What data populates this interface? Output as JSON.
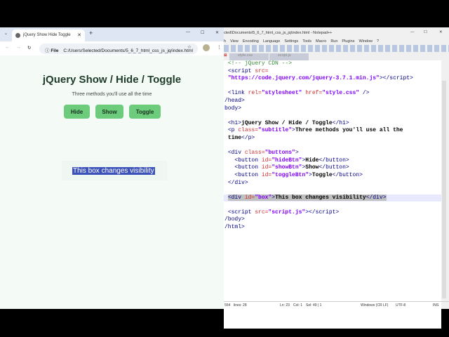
{
  "browser": {
    "tab_title": "jQuery Show Hide Toggle",
    "file_label": "File",
    "url": "C:/Users/Selected/Documents/5_6_7_html_css_js_jq/index.html",
    "page": {
      "title": "jQuery Show / Hide / Toggle",
      "subtitle": "Three methods you'll use all the time",
      "buttons": [
        "Hide",
        "Show",
        "Toggle"
      ],
      "box": "This box changes visibility"
    }
  },
  "notepad": {
    "title": "cted\\Documents\\5_6_7_html_css_js_jq\\index.html - Notepad++",
    "menu": [
      "h",
      "View",
      "Encoding",
      "Language",
      "Settings",
      "Tools",
      "Macro",
      "Run",
      "Plugins",
      "Window",
      "?"
    ],
    "tabs": [
      "style.css",
      "script.js"
    ],
    "code": [
      [
        [
          "<!-- jQuery CDN -->",
          "cm"
        ]
      ],
      [
        [
          "<script ",
          "tag"
        ],
        [
          "src=",
          "an"
        ]
      ],
      [
        [
          "\"https://code.jquery.com/jquery-3.7.1.min.js\"",
          "av"
        ],
        [
          "></script>",
          "tag"
        ]
      ],
      [],
      [
        [
          "<link ",
          "tag"
        ],
        [
          "rel=",
          "an"
        ],
        [
          "\"stylesheet\"",
          "av"
        ],
        [
          " href=",
          "an"
        ],
        [
          "\"style.css\"",
          "av"
        ],
        [
          " />",
          "tag"
        ]
      ],
      [
        [
          "/head>",
          "tag"
        ]
      ],
      [
        [
          "body>",
          "tag"
        ]
      ],
      [],
      [
        [
          "<h1>",
          "tag"
        ],
        [
          "jQuery Show / Hide / Toggle",
          "tx"
        ],
        [
          "</h1>",
          "tag"
        ]
      ],
      [
        [
          "<p ",
          "tag"
        ],
        [
          "class=",
          "an"
        ],
        [
          "\"subtitle\"",
          "av"
        ],
        [
          ">",
          "tag"
        ],
        [
          "Three methods you'll use all the",
          "tx"
        ]
      ],
      [
        [
          "time",
          "tx"
        ],
        [
          "</p>",
          "tag"
        ]
      ],
      [],
      [
        [
          "<div ",
          "tag"
        ],
        [
          "class=",
          "an"
        ],
        [
          "\"buttons\"",
          "av"
        ],
        [
          ">",
          "tag"
        ]
      ],
      [
        [
          "  <button ",
          "tag"
        ],
        [
          "id=",
          "an"
        ],
        [
          "\"hideBtn\"",
          "av"
        ],
        [
          ">",
          "tag"
        ],
        [
          "Hide",
          "tx"
        ],
        [
          "</button>",
          "tag"
        ]
      ],
      [
        [
          "  <button ",
          "tag"
        ],
        [
          "id=",
          "an"
        ],
        [
          "\"showBtn\"",
          "av"
        ],
        [
          ">",
          "tag"
        ],
        [
          "Show",
          "tx"
        ],
        [
          "</button>",
          "tag"
        ]
      ],
      [
        [
          "  <button ",
          "tag"
        ],
        [
          "id=",
          "an"
        ],
        [
          "\"toggleBtn\"",
          "av"
        ],
        [
          ">",
          "tag"
        ],
        [
          "Toggle",
          "tx"
        ],
        [
          "</button>",
          "tag"
        ]
      ],
      [
        [
          "</div>",
          "tag"
        ]
      ],
      [],
      [
        [
          "<div ",
          "tag"
        ],
        [
          "id=",
          "an"
        ],
        [
          "\"box\"",
          "av"
        ],
        [
          ">",
          "tag"
        ],
        [
          "This box changes visibility",
          "tx"
        ],
        [
          "</div>",
          "tag"
        ]
      ],
      [],
      [
        [
          "<script ",
          "tag"
        ],
        [
          "src=",
          "an"
        ],
        [
          "\"script.js\"",
          "av"
        ],
        [
          "></script>",
          "tag"
        ]
      ],
      [
        [
          "/body>",
          "tag"
        ]
      ],
      [
        [
          "/html>",
          "tag"
        ]
      ]
    ],
    "indent_flags": [
      1,
      1,
      1,
      0,
      1,
      0,
      0,
      0,
      1,
      1,
      1,
      0,
      1,
      1,
      1,
      1,
      1,
      0,
      1,
      0,
      1,
      0,
      0
    ],
    "highlighted_line": 18,
    "status": {
      "length": "554",
      "lines": "lines: 28",
      "ln": "Ln: 23",
      "col": "Col: 1",
      "sel": "Sel: 49 | 1",
      "eol": "Windows (CR LF)",
      "enc": "UTF-8",
      "mode": "INS"
    }
  }
}
